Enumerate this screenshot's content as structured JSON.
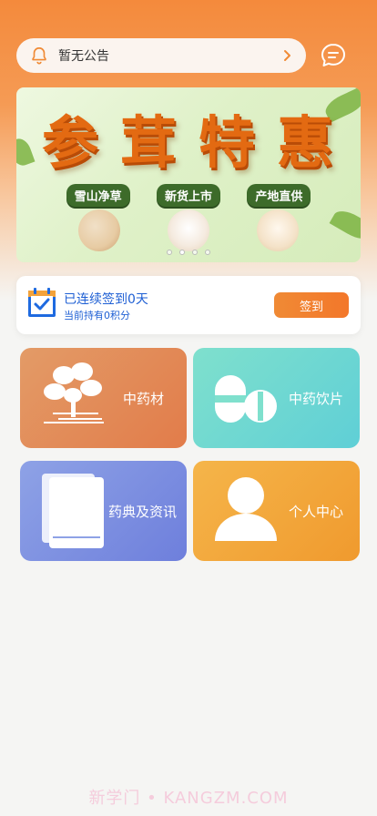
{
  "notice": {
    "text": "暂无公告",
    "icon": "bell-icon",
    "arrow_icon": "chevron-right-icon"
  },
  "message_icon": "chat-bubble-icon",
  "banner": {
    "title_chars": [
      "参",
      "茸",
      "特",
      "惠"
    ],
    "tags": [
      "雪山净草",
      "新货上市",
      "产地直供"
    ],
    "slides": 4,
    "active_slide": 1
  },
  "signin": {
    "line1": "已连续签到0天",
    "line2": "当前持有0积分",
    "button": "签到",
    "icon": "calendar-check-icon"
  },
  "tiles": [
    {
      "label": "中药材",
      "icon": "herb-plant-icon",
      "color": "#e27c4a"
    },
    {
      "label": "中药饮片",
      "icon": "pills-icon",
      "color": "#5fcfd6"
    },
    {
      "label": "药典及资讯",
      "icon": "book-icon",
      "color": "#6e7fdc"
    },
    {
      "label": "个人中心",
      "icon": "user-icon",
      "color": "#f09a2e"
    }
  ],
  "watermark": "新学门 • KANGZM.COM",
  "colors": {
    "accent": "#f3772a",
    "link_blue": "#1e5fd4"
  }
}
